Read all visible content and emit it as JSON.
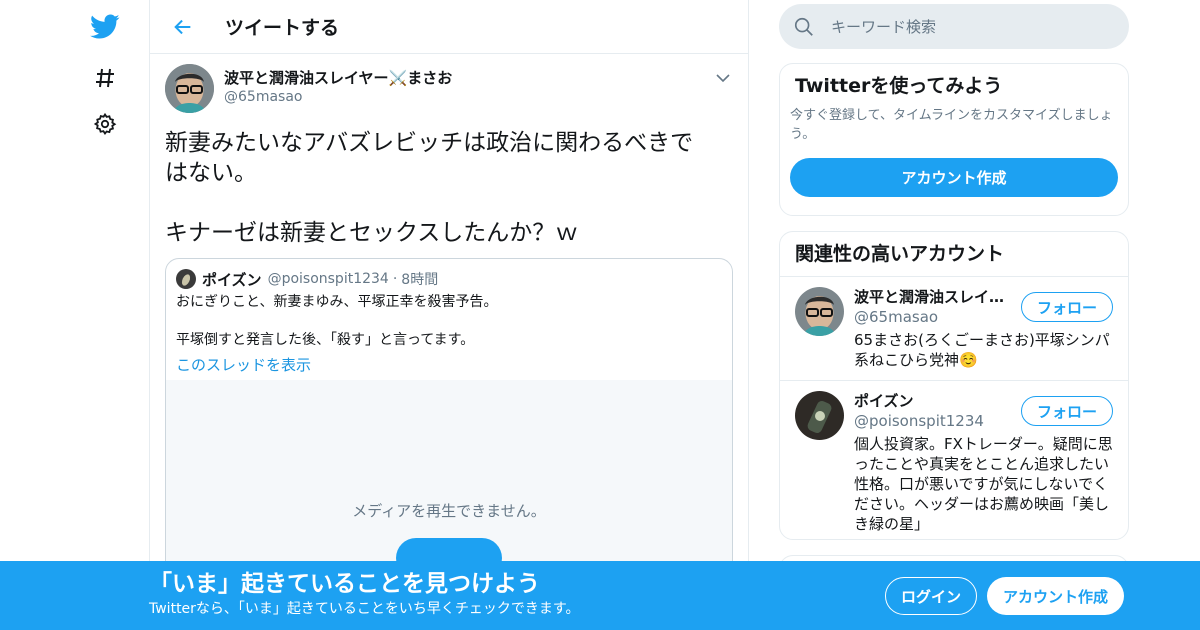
{
  "colors": {
    "brand": "#1da1f2",
    "text": "#14171a",
    "secondary": "#657786",
    "link": "#1b95e0",
    "border": "#e6ecf0",
    "banner": "#1da1f2"
  },
  "nav": {
    "icons": [
      "twitter-bird-icon",
      "hashtag-icon",
      "gear-icon"
    ]
  },
  "header": {
    "back_icon": "arrow-left-icon",
    "title": "ツイートする"
  },
  "tweet": {
    "author_name": "波平と潤滑油スレイヤー⚔️まさお",
    "author_handle": "@65masao",
    "text": "新妻みたいなアバズレビッチは政治に関わるべきで\nはない。\n\nキナーゼは新妻とセックスしたんか？ｗ",
    "menu_icon": "chevron-down-icon",
    "quote": {
      "name": "ポイズン",
      "handle": "@poisonspit1234",
      "separator": "·",
      "time": "8時間",
      "line1": "おにぎりこと、新妻まゆみ、平塚正幸を殺害予告。",
      "line2": "平塚倒すと発言した後、「殺す」と言ってます。",
      "thread_link": "このスレッドを表示",
      "media_message": "メディアを再生できません。"
    }
  },
  "search": {
    "placeholder": "キーワード検索",
    "icon": "search-icon"
  },
  "signup_card": {
    "title": "Twitterを使ってみよう",
    "description": "今すぐ登録して、タイムラインをカスタマイズしましょう。",
    "button": "アカウント作成"
  },
  "related": {
    "title": "関連性の高いアカウント",
    "accounts": [
      {
        "name": "波平と潤滑油スレイ…",
        "handle": "@65masao",
        "bio": "65まさお(ろくごーまさお)平塚シンパ系ねこひら党神☺️",
        "follow": "フォロー"
      },
      {
        "name": "ポイズン",
        "handle": "@poisonspit1234",
        "bio": "個人投資家。FXトレーダー。疑問に思ったことや真実をとことん追求したい性格。口が悪いですが気にしないでください。ヘッダーはお薦め映画「美しき緑の星」",
        "follow": "フォロー"
      }
    ]
  },
  "banner": {
    "title": "「いま」起きていることを見つけよう",
    "subtitle": "Twitterなら、「いま」起きていることをいち早くチェックできます。",
    "login": "ログイン",
    "signup": "アカウント作成"
  }
}
